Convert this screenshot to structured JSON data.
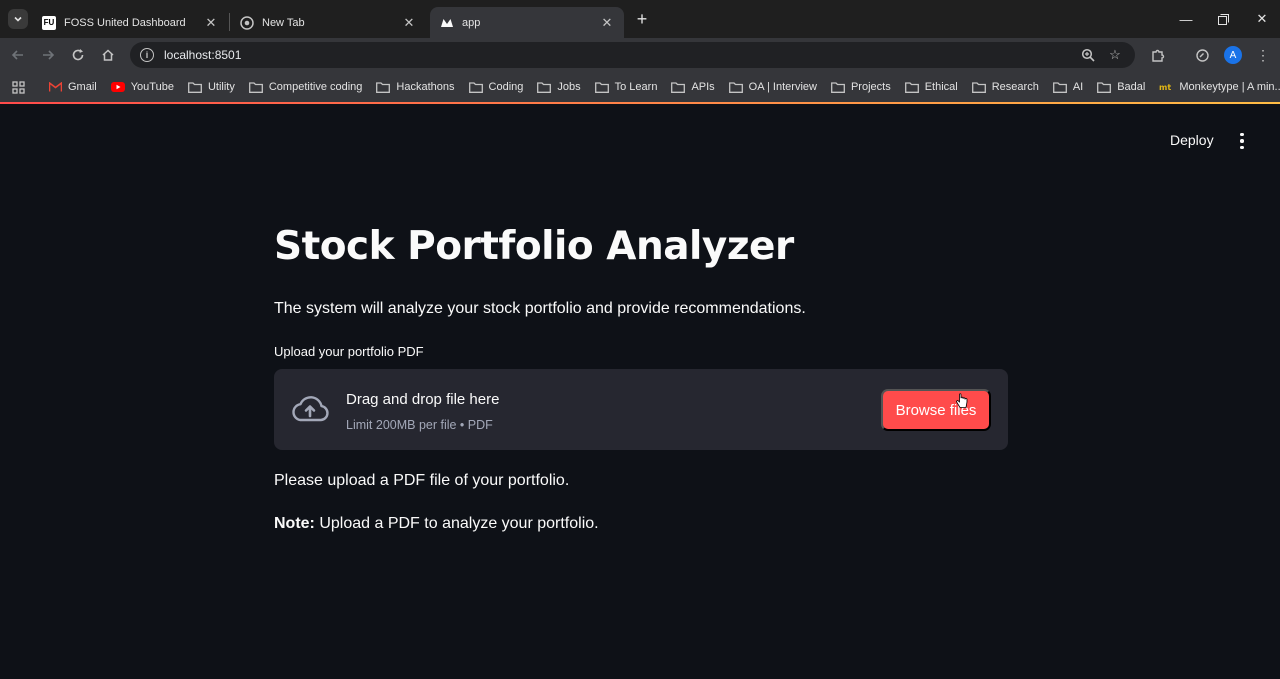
{
  "browser": {
    "tabs": [
      {
        "title": "FOSS United Dashboard",
        "favicon": "FU",
        "active": false
      },
      {
        "title": "New Tab",
        "favicon": "chrome-icon",
        "active": false
      },
      {
        "title": "app",
        "favicon": "streamlit-icon",
        "active": true
      }
    ],
    "url": "localhost:8501",
    "profile_initial": "A",
    "bookmarks": [
      {
        "label": "Gmail",
        "icon": "gmail-icon"
      },
      {
        "label": "YouTube",
        "icon": "youtube-icon"
      },
      {
        "label": "Utility",
        "icon": "folder-icon"
      },
      {
        "label": "Competitive coding",
        "icon": "folder-icon"
      },
      {
        "label": "Hackathons",
        "icon": "folder-icon"
      },
      {
        "label": "Coding",
        "icon": "folder-icon"
      },
      {
        "label": "Jobs",
        "icon": "folder-icon"
      },
      {
        "label": "To Learn",
        "icon": "folder-icon"
      },
      {
        "label": "APIs",
        "icon": "folder-icon"
      },
      {
        "label": "OA | Interview",
        "icon": "folder-icon"
      },
      {
        "label": "Projects",
        "icon": "folder-icon"
      },
      {
        "label": "Ethical",
        "icon": "folder-icon"
      },
      {
        "label": "Research",
        "icon": "folder-icon"
      },
      {
        "label": "AI",
        "icon": "folder-icon"
      },
      {
        "label": "Badal",
        "icon": "folder-icon"
      },
      {
        "label": "Monkeytype | A min...",
        "icon": "monkeytype-icon"
      }
    ]
  },
  "app": {
    "deploy_label": "Deploy",
    "title": "Stock Portfolio Analyzer",
    "description": "The system will analyze your stock portfolio and provide recommendations.",
    "uploader": {
      "label": "Upload your portfolio PDF",
      "drop_text": "Drag and drop file here",
      "limit_text": "Limit 200MB per file • PDF",
      "button_label": "Browse files"
    },
    "message": "Please upload a PDF file of your portfolio.",
    "note_label": "Note:",
    "note_text": " Upload a PDF to analyze your portfolio."
  },
  "colors": {
    "background": "#0e1117",
    "dropzone": "#262730",
    "accent": "#ff4b4b",
    "text": "#fafafa",
    "muted": "#a3a8b8"
  }
}
